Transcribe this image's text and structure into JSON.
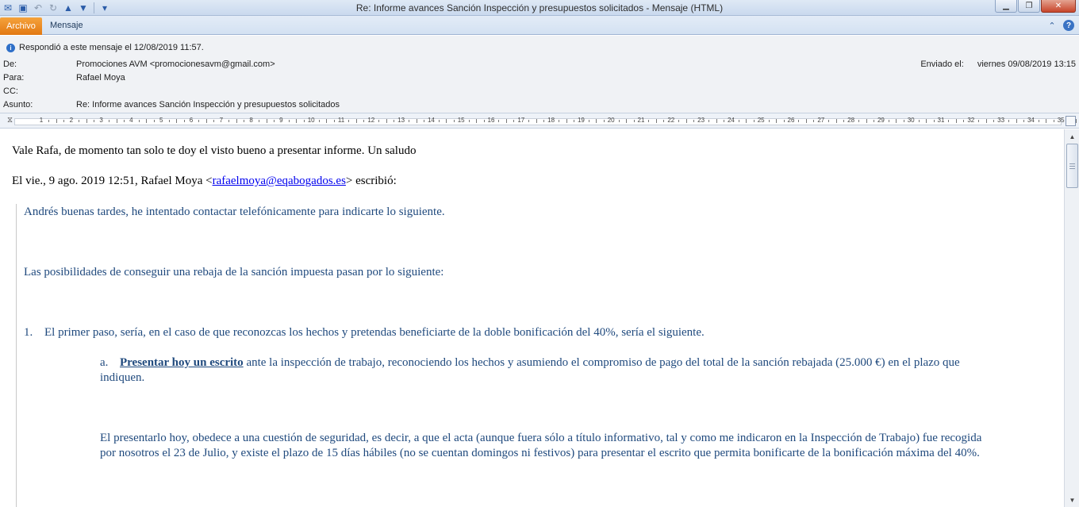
{
  "window": {
    "title": "Re: Informe avances Sanción Inspección y presupuestos solicitados  -  Mensaje (HTML)"
  },
  "ribbon": {
    "tab_file": "Archivo",
    "tab_message": "Mensaje"
  },
  "infobar": {
    "text": "Respondió a este mensaje el 12/08/2019 11:57."
  },
  "header": {
    "from_label": "De:",
    "from_value": "Promociones AVM <promocionesavm@gmail.com>",
    "to_label": "Para:",
    "to_value": "Rafael Moya",
    "cc_label": "CC:",
    "cc_value": "",
    "subject_label": "Asunto:",
    "subject_value": "Re: Informe avances Sanción Inspección y presupuestos solicitados",
    "sent_label": "Enviado el:",
    "sent_value": "viernes 09/08/2019 13:15"
  },
  "ruler": {
    "numbers": [
      "1",
      "2",
      "3",
      "4",
      "5",
      "6",
      "7",
      "8",
      "9",
      "10",
      "11",
      "12",
      "13",
      "14",
      "15",
      "16",
      "17",
      "18",
      "19",
      "20",
      "21",
      "22",
      "23",
      "24",
      "25",
      "26",
      "27",
      "28",
      "29",
      "30",
      "31",
      "32",
      "33",
      "34",
      "35"
    ]
  },
  "body": {
    "reply_line": "Vale Rafa, de momento tan solo te doy el visto bueno a presentar informe. Un saludo",
    "attribution_prefix": "El vie., 9 ago. 2019 12:51, Rafael Moya <",
    "attribution_email": "rafaelmoya@eqabogados.es",
    "attribution_suffix": "> escribió:",
    "q1": "Andrés buenas tardes, he intentado contactar telefónicamente para indicarte lo siguiente.",
    "q2": "Las posibilidades de conseguir una rebaja de la sanción impuesta pasan por lo siguiente:",
    "item1_num": "1.",
    "item1_text": "El primer paso, sería, en el caso de que reconozcas los hechos y pretendas beneficiarte de la doble bonificación del 40%, sería el siguiente.",
    "sub_a_letter": "a.",
    "sub_a_bold": "Presentar hoy un escrito",
    "sub_a_rest": " ante la inspección de trabajo, reconociendo los hechos y asumiendo el compromiso de pago del total de la sanción rebajada (25.000 €) en el plazo que",
    "sub_a_cont": "indiquen.",
    "para2_line1": "El presentarlo hoy, obedece a una cuestión de seguridad, es decir, a que el acta (aunque fuera sólo a título informativo, tal y como me indicaron en la Inspección de Trabajo) fue recogida",
    "para2_line2": "por nosotros el 23 de Julio, y existe el plazo de 15 días hábiles (no se cuentan domingos ni festivos) para presentar el escrito que permita bonificarte de la bonificación máxima del 40%."
  }
}
